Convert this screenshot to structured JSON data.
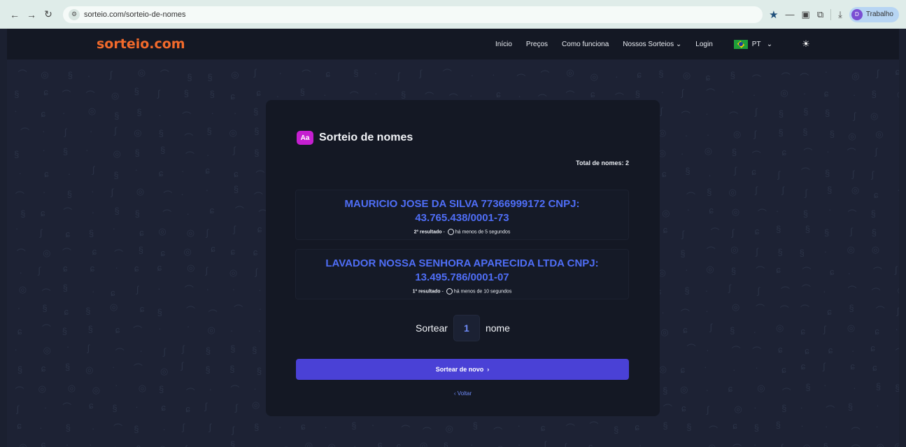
{
  "browser": {
    "url": "sorteio.com/sorteio-de-nomes",
    "profile_name": "Trabalho",
    "profile_initial": "D"
  },
  "header": {
    "logo": "sorteio.com",
    "nav": [
      "Início",
      "Preços",
      "Como funciona",
      "Nossos Sorteios"
    ],
    "login": "Login",
    "language": "PT"
  },
  "card": {
    "icon_text": "Aa",
    "title": "Sorteio de nomes",
    "total_label": "Total de nomes:",
    "total_value": "2",
    "results": [
      {
        "name": "MAURICIO JOSE DA SILVA 77366999172 CNPJ: 43.765.438/0001-73",
        "rank": "2º resultado",
        "time": "há menos de 5 segundos"
      },
      {
        "name": "LAVADOR NOSSA SENHORA APARECIDA LTDA CNPJ: 13.495.786/0001-07",
        "rank": "1º resultado",
        "time": "há menos de 10 segundos"
      }
    ],
    "draw_prefix": "Sortear",
    "draw_qty": "1",
    "draw_suffix": "nome",
    "redraw_button": "Sortear de novo",
    "back_link": "Voltar"
  },
  "colors": {
    "accent": "#4a41d6",
    "logo": "#f26a2b",
    "result_text": "#4f6ef7"
  }
}
